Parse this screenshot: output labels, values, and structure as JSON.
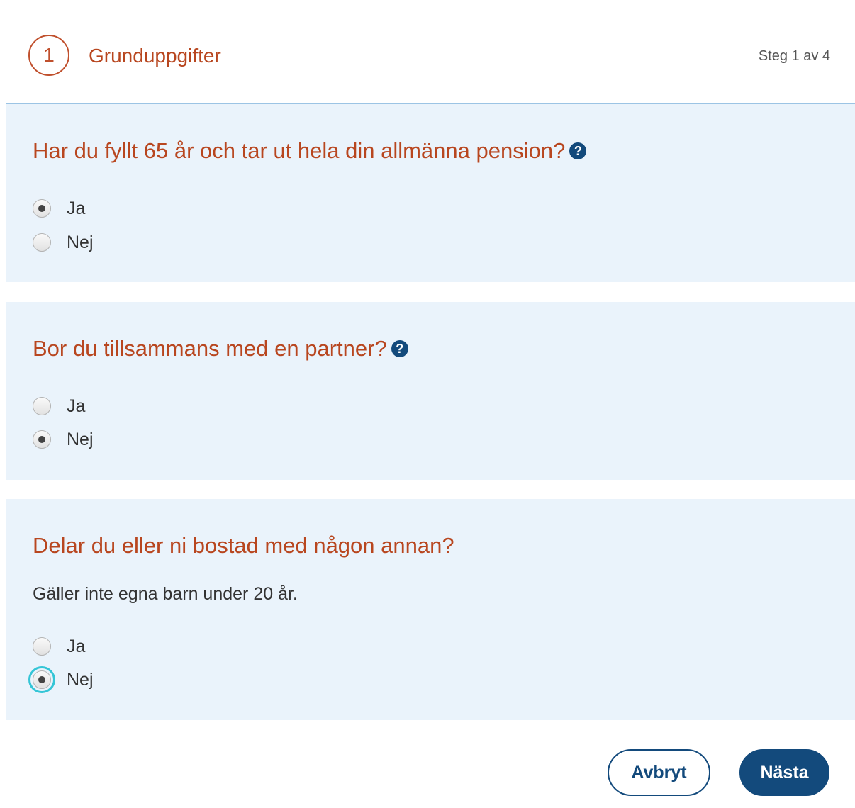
{
  "header": {
    "step_number": "1",
    "step_title": "Grunduppgifter",
    "step_counter": "Steg 1 av 4"
  },
  "questions": [
    {
      "text": "Har du fyllt 65 år och tar ut hela din allmänna pension?",
      "has_help": true,
      "options": [
        {
          "label": "Ja",
          "checked": true
        },
        {
          "label": "Nej",
          "checked": false
        }
      ]
    },
    {
      "text": "Bor du tillsammans med en partner?",
      "has_help": true,
      "options": [
        {
          "label": "Ja",
          "checked": false
        },
        {
          "label": "Nej",
          "checked": true
        }
      ]
    },
    {
      "text": "Delar du eller ni bostad med någon annan?",
      "hint": "Gäller inte egna barn under 20 år.",
      "has_help": false,
      "options": [
        {
          "label": "Ja",
          "checked": false
        },
        {
          "label": "Nej",
          "checked": true,
          "focused": true
        }
      ]
    }
  ],
  "help_icon": {
    "icon": "question-circle-icon",
    "glyph": "?"
  },
  "buttons": {
    "cancel_label": "Avbryt",
    "next_label": "Nästa"
  },
  "colors": {
    "accent_orange": "#b8461f",
    "primary_blue": "#134a7c",
    "section_background": "#eaf3fb",
    "focus_ring": "#34c5d6"
  }
}
